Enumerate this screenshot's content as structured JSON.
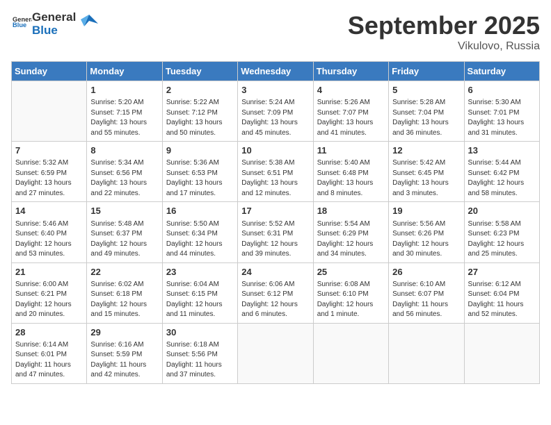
{
  "header": {
    "logo_general": "General",
    "logo_blue": "Blue",
    "month_year": "September 2025",
    "location": "Vikulovo, Russia"
  },
  "days_of_week": [
    "Sunday",
    "Monday",
    "Tuesday",
    "Wednesday",
    "Thursday",
    "Friday",
    "Saturday"
  ],
  "weeks": [
    [
      {
        "day": "",
        "sunrise": "",
        "sunset": "",
        "daylight": ""
      },
      {
        "day": "1",
        "sunrise": "5:20 AM",
        "sunset": "7:15 PM",
        "daylight": "13 hours and 55 minutes."
      },
      {
        "day": "2",
        "sunrise": "5:22 AM",
        "sunset": "7:12 PM",
        "daylight": "13 hours and 50 minutes."
      },
      {
        "day": "3",
        "sunrise": "5:24 AM",
        "sunset": "7:09 PM",
        "daylight": "13 hours and 45 minutes."
      },
      {
        "day": "4",
        "sunrise": "5:26 AM",
        "sunset": "7:07 PM",
        "daylight": "13 hours and 41 minutes."
      },
      {
        "day": "5",
        "sunrise": "5:28 AM",
        "sunset": "7:04 PM",
        "daylight": "13 hours and 36 minutes."
      },
      {
        "day": "6",
        "sunrise": "5:30 AM",
        "sunset": "7:01 PM",
        "daylight": "13 hours and 31 minutes."
      }
    ],
    [
      {
        "day": "7",
        "sunrise": "5:32 AM",
        "sunset": "6:59 PM",
        "daylight": "13 hours and 27 minutes."
      },
      {
        "day": "8",
        "sunrise": "5:34 AM",
        "sunset": "6:56 PM",
        "daylight": "13 hours and 22 minutes."
      },
      {
        "day": "9",
        "sunrise": "5:36 AM",
        "sunset": "6:53 PM",
        "daylight": "13 hours and 17 minutes."
      },
      {
        "day": "10",
        "sunrise": "5:38 AM",
        "sunset": "6:51 PM",
        "daylight": "13 hours and 12 minutes."
      },
      {
        "day": "11",
        "sunrise": "5:40 AM",
        "sunset": "6:48 PM",
        "daylight": "13 hours and 8 minutes."
      },
      {
        "day": "12",
        "sunrise": "5:42 AM",
        "sunset": "6:45 PM",
        "daylight": "13 hours and 3 minutes."
      },
      {
        "day": "13",
        "sunrise": "5:44 AM",
        "sunset": "6:42 PM",
        "daylight": "12 hours and 58 minutes."
      }
    ],
    [
      {
        "day": "14",
        "sunrise": "5:46 AM",
        "sunset": "6:40 PM",
        "daylight": "12 hours and 53 minutes."
      },
      {
        "day": "15",
        "sunrise": "5:48 AM",
        "sunset": "6:37 PM",
        "daylight": "12 hours and 49 minutes."
      },
      {
        "day": "16",
        "sunrise": "5:50 AM",
        "sunset": "6:34 PM",
        "daylight": "12 hours and 44 minutes."
      },
      {
        "day": "17",
        "sunrise": "5:52 AM",
        "sunset": "6:31 PM",
        "daylight": "12 hours and 39 minutes."
      },
      {
        "day": "18",
        "sunrise": "5:54 AM",
        "sunset": "6:29 PM",
        "daylight": "12 hours and 34 minutes."
      },
      {
        "day": "19",
        "sunrise": "5:56 AM",
        "sunset": "6:26 PM",
        "daylight": "12 hours and 30 minutes."
      },
      {
        "day": "20",
        "sunrise": "5:58 AM",
        "sunset": "6:23 PM",
        "daylight": "12 hours and 25 minutes."
      }
    ],
    [
      {
        "day": "21",
        "sunrise": "6:00 AM",
        "sunset": "6:21 PM",
        "daylight": "12 hours and 20 minutes."
      },
      {
        "day": "22",
        "sunrise": "6:02 AM",
        "sunset": "6:18 PM",
        "daylight": "12 hours and 15 minutes."
      },
      {
        "day": "23",
        "sunrise": "6:04 AM",
        "sunset": "6:15 PM",
        "daylight": "12 hours and 11 minutes."
      },
      {
        "day": "24",
        "sunrise": "6:06 AM",
        "sunset": "6:12 PM",
        "daylight": "12 hours and 6 minutes."
      },
      {
        "day": "25",
        "sunrise": "6:08 AM",
        "sunset": "6:10 PM",
        "daylight": "12 hours and 1 minute."
      },
      {
        "day": "26",
        "sunrise": "6:10 AM",
        "sunset": "6:07 PM",
        "daylight": "11 hours and 56 minutes."
      },
      {
        "day": "27",
        "sunrise": "6:12 AM",
        "sunset": "6:04 PM",
        "daylight": "11 hours and 52 minutes."
      }
    ],
    [
      {
        "day": "28",
        "sunrise": "6:14 AM",
        "sunset": "6:01 PM",
        "daylight": "11 hours and 47 minutes."
      },
      {
        "day": "29",
        "sunrise": "6:16 AM",
        "sunset": "5:59 PM",
        "daylight": "11 hours and 42 minutes."
      },
      {
        "day": "30",
        "sunrise": "6:18 AM",
        "sunset": "5:56 PM",
        "daylight": "11 hours and 37 minutes."
      },
      {
        "day": "",
        "sunrise": "",
        "sunset": "",
        "daylight": ""
      },
      {
        "day": "",
        "sunrise": "",
        "sunset": "",
        "daylight": ""
      },
      {
        "day": "",
        "sunrise": "",
        "sunset": "",
        "daylight": ""
      },
      {
        "day": "",
        "sunrise": "",
        "sunset": "",
        "daylight": ""
      }
    ]
  ]
}
